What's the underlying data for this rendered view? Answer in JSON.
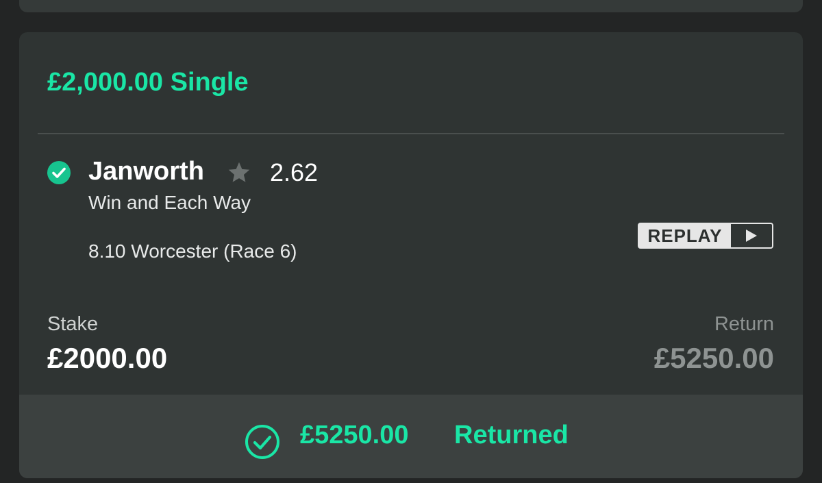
{
  "bet": {
    "title": "£2,000.00 Single",
    "selection": {
      "name": "Janworth",
      "odds": "2.62",
      "bet_type": "Win and Each Way",
      "event": "8.10 Worcester (Race 6)",
      "status_icon": "check-circle-icon",
      "favourite_icon": "star-icon"
    },
    "replay": {
      "label": "REPLAY",
      "icon": "play-icon"
    },
    "stake": {
      "label": "Stake",
      "value": "£2000.00"
    },
    "return": {
      "label": "Return",
      "value": "£5250.00"
    },
    "footer": {
      "amount": "£5250.00",
      "status": "Returned",
      "icon": "check-circle-outline-icon"
    }
  },
  "colors": {
    "accent": "#1ae6a6",
    "card_bg": "#2f3433",
    "footer_bg": "#3c4140",
    "page_bg": "#232525",
    "muted_text": "#8e9392"
  }
}
